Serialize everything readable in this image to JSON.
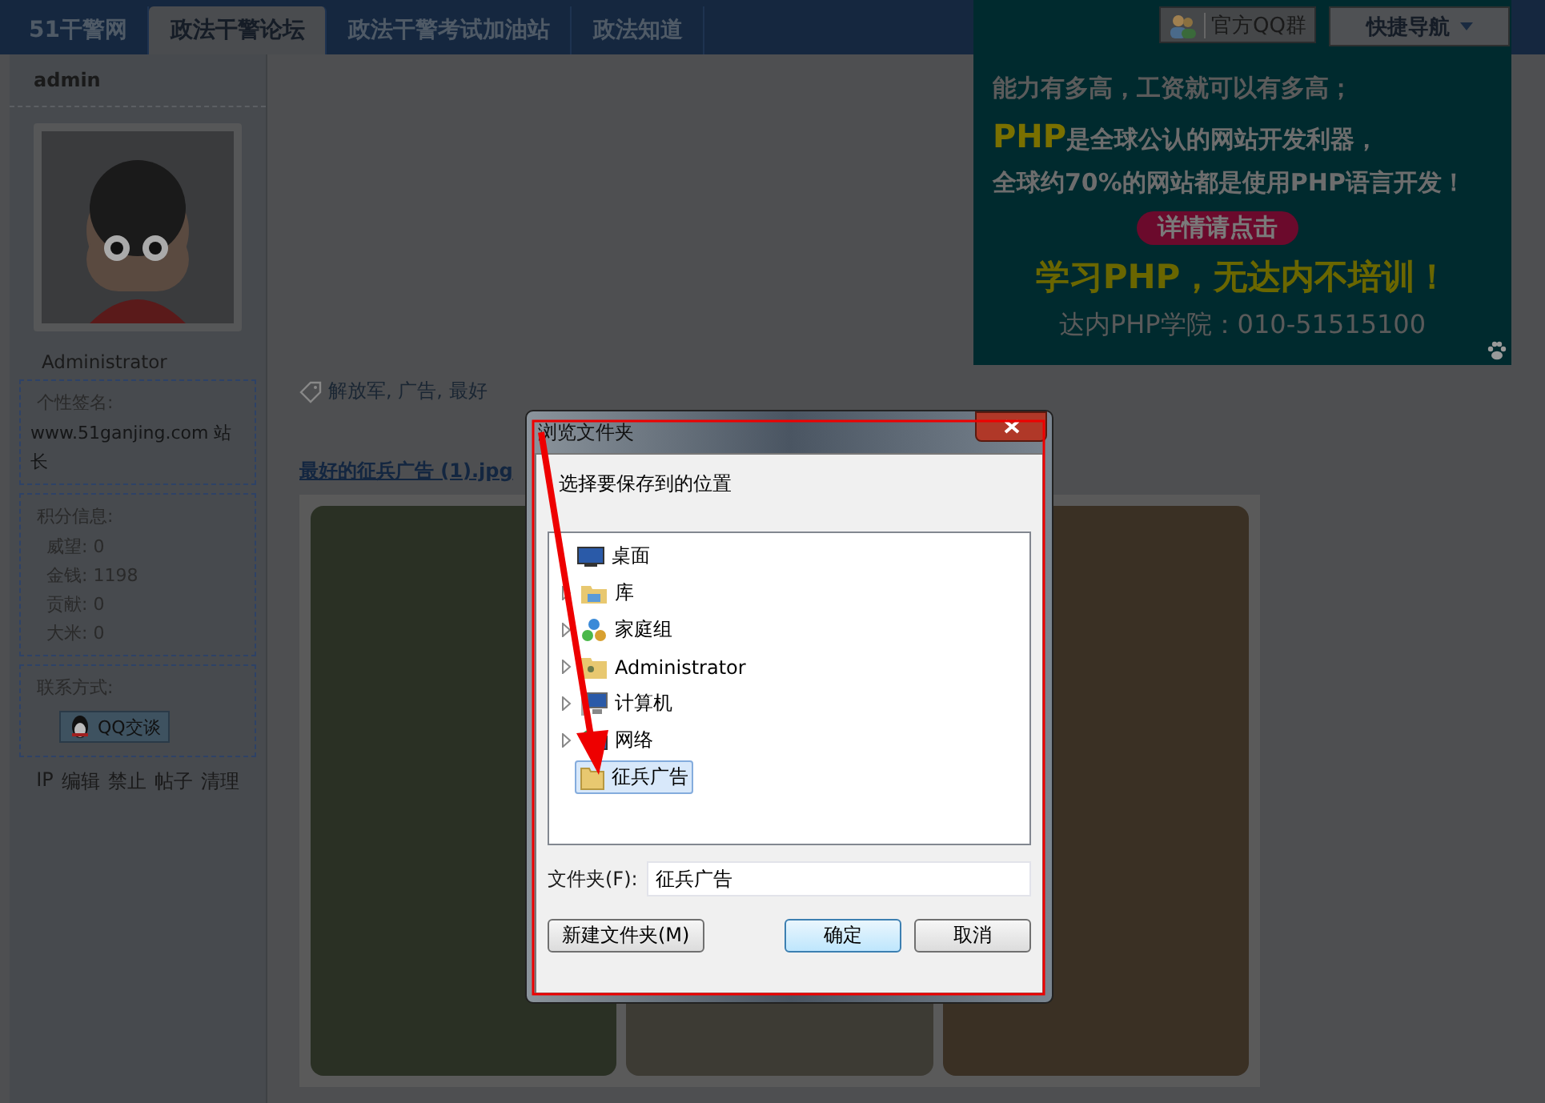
{
  "nav": {
    "tabs": [
      {
        "label": "51干警网",
        "selected": false
      },
      {
        "label": "政法干警论坛",
        "selected": true
      },
      {
        "label": "政法干警考试加油站",
        "selected": false
      },
      {
        "label": "政法知道",
        "selected": false
      }
    ],
    "qq_group": "官方QQ群",
    "quick_nav": "快捷导航"
  },
  "profile": {
    "username": "admin",
    "role": "Administrator",
    "signature_label": "个性签名:",
    "signature": "www.51ganjing.com 站长",
    "points_label": "积分信息:",
    "points": [
      {
        "label": "威望:",
        "value": "0"
      },
      {
        "label": "金钱:",
        "value": "1198"
      },
      {
        "label": "贡献:",
        "value": "0"
      },
      {
        "label": "大米:",
        "value": "0"
      }
    ],
    "contact_label": "联系方式:",
    "qq_button": "QQ交谈",
    "admin_links": [
      "IP",
      "编辑",
      "禁止",
      "帖子",
      "清理"
    ]
  },
  "ad": {
    "line_2": "能力有多高，工资就可以有多高；",
    "line_3_brand": "PHP",
    "line_3": "是全球公认的网站开发利器，",
    "line_4": "全球约70%的网站都是使用PHP语言开发！",
    "button": "详情请点击",
    "slogan": "学习PHP，无达内不培训！",
    "contact": "达内PHP学院：010-51515100"
  },
  "post": {
    "tags": "解放军, 广告, 最好",
    "attachment": "最好的征兵广告 (1).jpg"
  },
  "dialog": {
    "title": "浏览文件夹",
    "prompt": "选择要保存到的位置",
    "tree": [
      {
        "label": "桌面",
        "kind": "desktop",
        "expandable": false,
        "selected": false
      },
      {
        "label": "库",
        "kind": "library",
        "expandable": true,
        "selected": false
      },
      {
        "label": "家庭组",
        "kind": "homegroup",
        "expandable": true,
        "selected": false
      },
      {
        "label": "Administrator",
        "kind": "user",
        "expandable": true,
        "selected": false
      },
      {
        "label": "计算机",
        "kind": "computer",
        "expandable": true,
        "selected": false
      },
      {
        "label": "网络",
        "kind": "network",
        "expandable": true,
        "selected": false
      },
      {
        "label": "征兵广告",
        "kind": "folder",
        "expandable": false,
        "selected": true
      }
    ],
    "folder_label": "文件夹(F):",
    "folder_value": "征兵广告",
    "new_folder": "新建文件夹(M)",
    "ok": "确定",
    "cancel": "取消"
  }
}
